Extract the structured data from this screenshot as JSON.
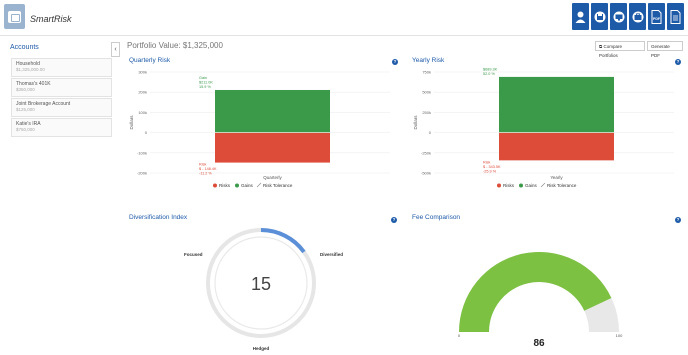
{
  "app": {
    "name": "SmartRisk"
  },
  "toolbar": {
    "icons": [
      "user-icon",
      "save-icon",
      "monitor-icon",
      "portfolio-icon",
      "pdf-icon",
      "document-icon"
    ],
    "pdf_label": "PDF"
  },
  "sidebar": {
    "title": "Accounts",
    "items": [
      {
        "name": "Household",
        "balance": "$1,325,000.00"
      },
      {
        "name": "Thomas's 401K",
        "balance": "$350,000"
      },
      {
        "name": "Joint Brokerage Account",
        "balance": "$125,000"
      },
      {
        "name": "Katie's IRA",
        "balance": "$750,000"
      }
    ],
    "collapse_glyph": "‹"
  },
  "header": {
    "portfolio_value": "Portfolio Value: $1,325,000",
    "compare_label": "Compare Portfolios",
    "generate_label": "Generate PDF"
  },
  "panels": {
    "quarterly": {
      "title": "Quarterly Risk",
      "help": "?"
    },
    "yearly": {
      "title": "Yearly Risk",
      "help": "?"
    },
    "diversification": {
      "title": "Diversification Index",
      "help": "?"
    },
    "fee": {
      "title": "Fee Comparison",
      "help": "?"
    }
  },
  "colors": {
    "accent": "#1d5aa8",
    "gain": "#3a9a4a",
    "risk": "#dd4b39",
    "gauge": "#7dc142"
  },
  "chart_data": [
    {
      "type": "bar",
      "title": "Quarterly Risk",
      "categories": [
        "Quarterly"
      ],
      "xlabel": "Quarterly",
      "ylabel": "Dollars",
      "ylim": [
        -200000,
        300000
      ],
      "yticks": [
        "300k",
        "200k",
        "100k",
        "0",
        "-100k",
        "-200k"
      ],
      "series": [
        {
          "name": "Gains",
          "values": [
            211000
          ],
          "label": [
            "Gain",
            "$211.0K",
            "15.9 %"
          ]
        },
        {
          "name": "Risks",
          "values": [
            -148400
          ],
          "label": [
            "Risk",
            "$ - 148.4K",
            "-11.2 %"
          ]
        }
      ],
      "legend": [
        "Risks",
        "Gains",
        "Risk Tolerance"
      ]
    },
    {
      "type": "bar",
      "title": "Yearly Risk",
      "categories": [
        "Yearly"
      ],
      "xlabel": "Yearly",
      "ylabel": "Dollars",
      "ylim": [
        -500000,
        750000
      ],
      "yticks": [
        "750k",
        "500k",
        "250k",
        "0",
        "-250k",
        "-500k"
      ],
      "series": [
        {
          "name": "Gains",
          "values": [
            689300
          ],
          "label": [
            "Gain",
            "$689.3K",
            "52.0 %"
          ]
        },
        {
          "name": "Risks",
          "values": [
            -343500
          ],
          "label": [
            "Risk",
            "$ - 343.5K",
            "-25.9 %"
          ]
        }
      ],
      "legend": [
        "Risks",
        "Gains",
        "Risk Tolerance"
      ]
    }
  ],
  "diversification": {
    "value": "15",
    "fraction": 0.15,
    "labels": {
      "focused": "Focused",
      "diversified": "Diversified",
      "hedged": "Hedged"
    }
  },
  "fee_gauge": {
    "value": "86",
    "fraction": 0.86,
    "min": "0",
    "max": "100"
  }
}
